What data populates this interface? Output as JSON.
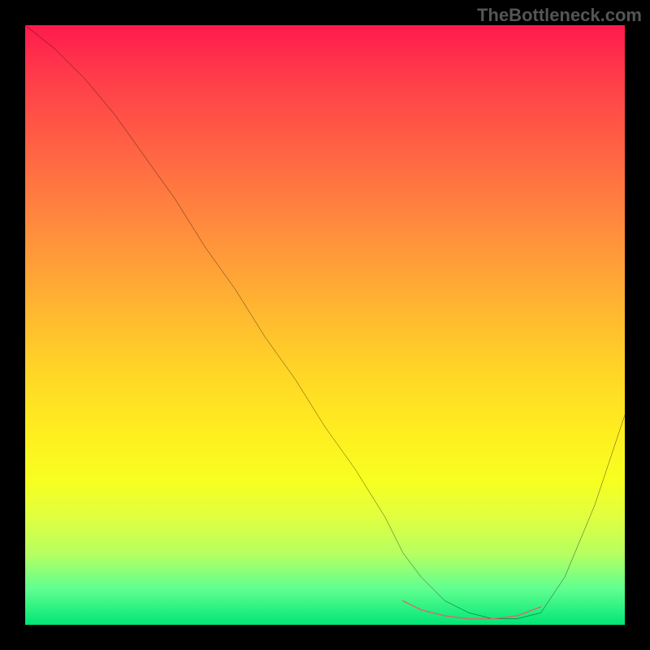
{
  "watermark": "TheBottleneck.com",
  "chart_data": {
    "type": "line",
    "title": "",
    "xlabel": "",
    "ylabel": "",
    "xlim": [
      0,
      100
    ],
    "ylim": [
      0,
      100
    ],
    "series": [
      {
        "name": "bottleneck-curve",
        "x": [
          0,
          5,
          10,
          15,
          20,
          25,
          30,
          35,
          40,
          45,
          50,
          55,
          60,
          63,
          66,
          70,
          74,
          78,
          82,
          86,
          90,
          95,
          100
        ],
        "values": [
          100,
          96,
          91,
          85,
          78,
          71,
          63,
          56,
          48,
          41,
          33,
          26,
          18,
          12,
          8,
          4,
          2,
          1,
          1,
          2,
          8,
          20,
          35
        ]
      },
      {
        "name": "optimal-range-marker",
        "x": [
          63,
          66,
          70,
          74,
          78,
          82,
          86
        ],
        "values": [
          4.0,
          2.5,
          1.5,
          1.0,
          1.0,
          1.5,
          3.0
        ]
      }
    ],
    "colors": {
      "curve": "#000000",
      "marker": "#d86b6b"
    }
  }
}
